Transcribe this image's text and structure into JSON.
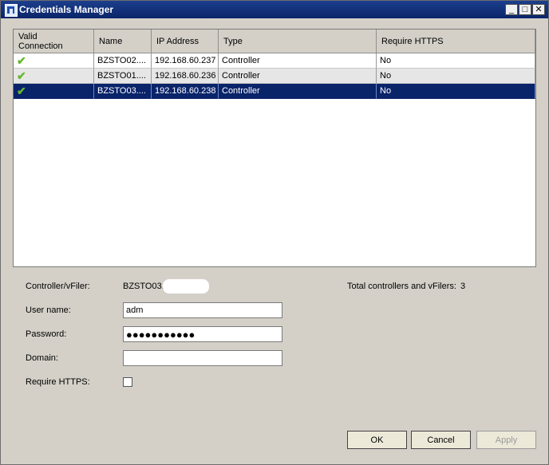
{
  "window": {
    "title": "Credentials Manager",
    "minimize_glyph": "_",
    "maximize_glyph": "□",
    "close_glyph": "✕"
  },
  "grid": {
    "columns": [
      "Valid\nConnection",
      "Name",
      "IP Address",
      "Type",
      "Require HTTPS"
    ],
    "rows": [
      {
        "valid": "✔",
        "name": "BZSTO02....",
        "ip": "192.168.60.237",
        "type": "Controller",
        "https": "No"
      },
      {
        "valid": "✔",
        "name": "BZSTO01....",
        "ip": "192.168.60.236",
        "type": "Controller",
        "https": "No"
      },
      {
        "valid": "✔",
        "name": "BZSTO03....",
        "ip": "192.168.60.238",
        "type": "Controller",
        "https": "No"
      }
    ]
  },
  "form": {
    "controller_label": "Controller/vFiler:",
    "controller_value": "BZSTO03.",
    "total_label": "Total controllers and vFilers:",
    "total_value": "3",
    "username_label": "User name:",
    "username_value": "adm",
    "password_label": "Password:",
    "password_value": "●●●●●●●●●●●",
    "domain_label": "Domain:",
    "domain_value": "",
    "https_label": "Require HTTPS:"
  },
  "buttons": {
    "ok": "OK",
    "cancel": "Cancel",
    "apply": "Apply"
  },
  "colors": {
    "selected_row": "#0a246a",
    "check": "#66b82c"
  }
}
